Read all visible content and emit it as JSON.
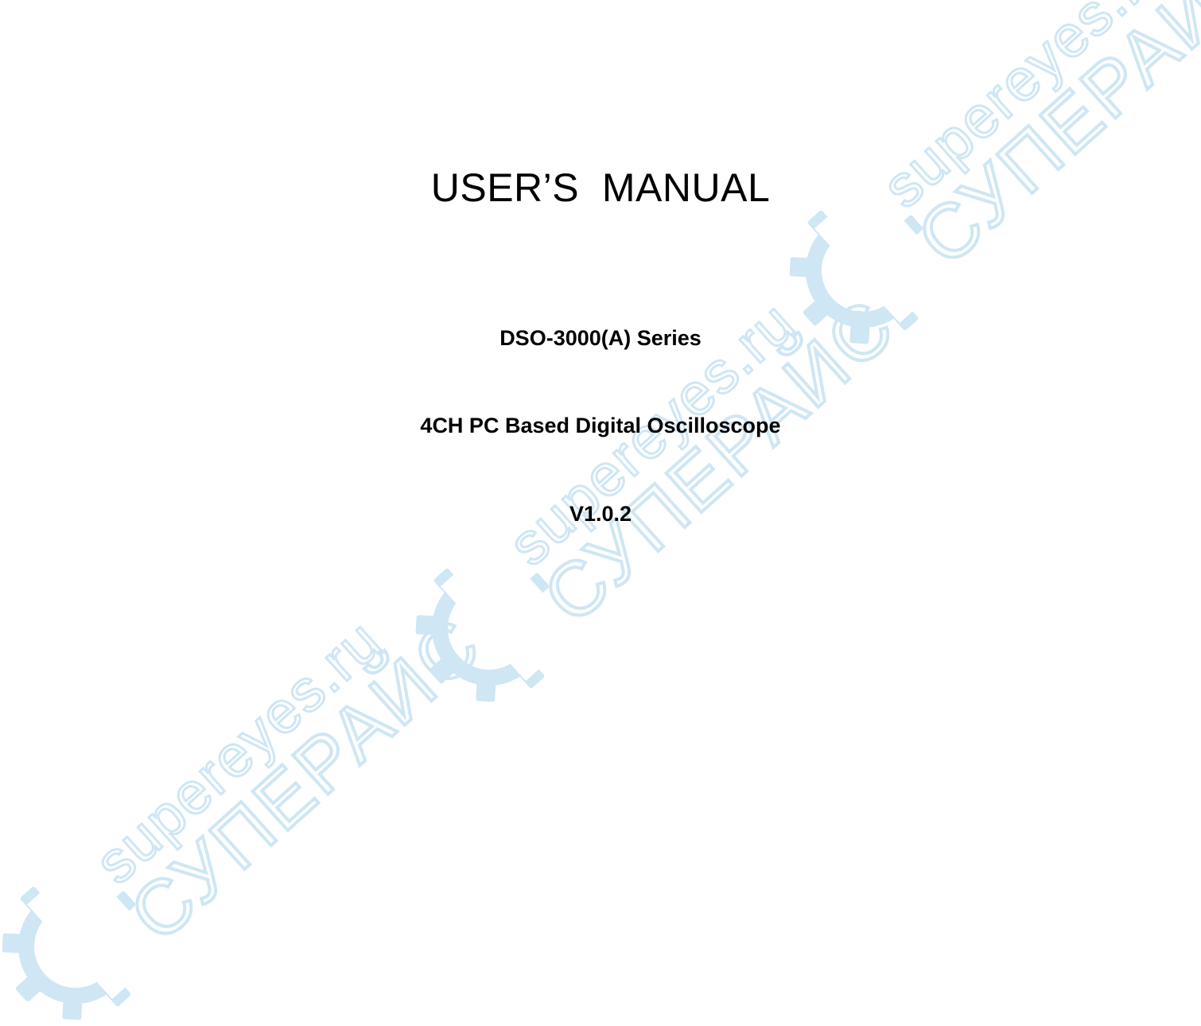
{
  "document": {
    "title": "USER’S  MANUAL",
    "series": "DSO-3000(A) Series",
    "product": "4CH PC Based Digital Oscilloscope",
    "version": "V1.0.2"
  },
  "watermark": {
    "text_latin": "supereyes.ru",
    "text_cyrillic": "СУПЕРАЙС",
    "color": "#cfe6f4",
    "icon": "gear-icon"
  }
}
